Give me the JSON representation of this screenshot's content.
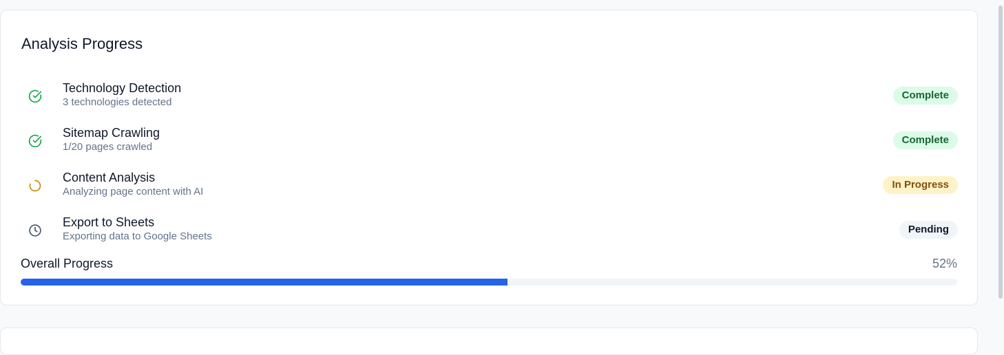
{
  "card": {
    "title": "Analysis Progress",
    "steps": [
      {
        "name": "Technology Detection",
        "description": "3 technologies detected",
        "status": "Complete",
        "icon": "check-circle-icon"
      },
      {
        "name": "Sitemap Crawling",
        "description": "1/20 pages crawled",
        "status": "Complete",
        "icon": "check-circle-icon"
      },
      {
        "name": "Content Analysis",
        "description": "Analyzing page content with AI",
        "status": "In Progress",
        "icon": "spinner-icon"
      },
      {
        "name": "Export to Sheets",
        "description": "Exporting data to Google Sheets",
        "status": "Pending",
        "icon": "clock-icon"
      }
    ],
    "overall": {
      "label": "Overall Progress",
      "value_text": "52%",
      "percent": 52
    }
  },
  "colors": {
    "complete": "#16a34a",
    "in_progress": "#ca8a04",
    "pending": "#475569",
    "progress_fill": "#2563eb"
  }
}
